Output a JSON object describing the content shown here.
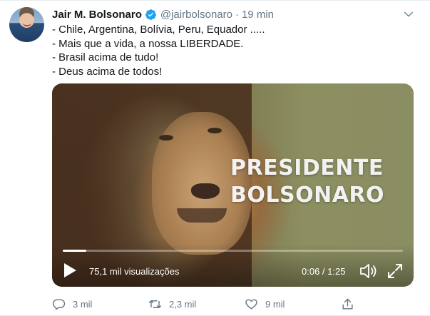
{
  "tweet": {
    "author_name": "Jair M. Bolsonaro",
    "handle": "@jairbolsonaro",
    "separator": "·",
    "time": "19 min",
    "lines": [
      "- Chile, Argentina, Bolívia, Peru, Equador .....",
      "- Mais que a vida, a nossa LIBERDADE.",
      "- Brasil acima de tudo!",
      "- Deus acima de todos!"
    ]
  },
  "video": {
    "overlay_line1": "PRESIDENTE",
    "overlay_line2": "BOLSONARO",
    "views": "75,1 mil visualizações",
    "time_display": "0:06 / 1:25",
    "progress_fraction": 0.07
  },
  "actions": {
    "reply_count": "3 mil",
    "retweet_count": "2,3 mil",
    "like_count": "9 mil",
    "share_count": ""
  },
  "colors": {
    "verified_blue": "#1da1f2",
    "muted_text": "#657786",
    "primary_text": "#14171a"
  },
  "icons": [
    "verified-badge-icon",
    "chevron-down-icon",
    "play-icon",
    "volume-icon",
    "fullscreen-icon",
    "reply-icon",
    "retweet-icon",
    "like-icon",
    "share-icon"
  ]
}
